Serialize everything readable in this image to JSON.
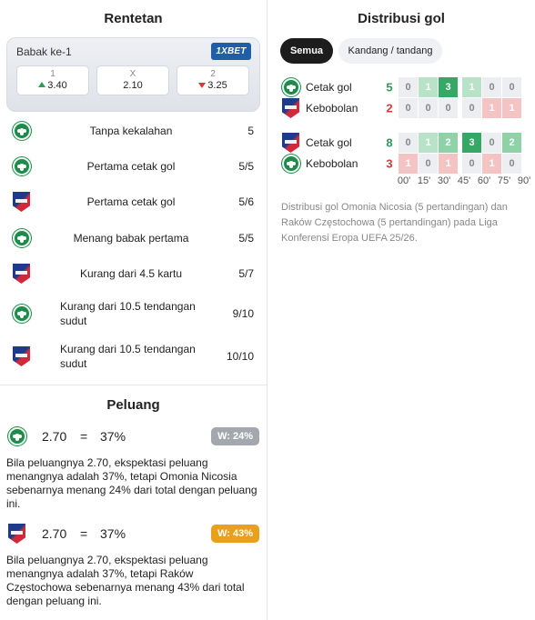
{
  "streak": {
    "title": "Rentetan",
    "odds": {
      "round": "Babak ke-1",
      "bookmaker": "1XBET",
      "items": [
        {
          "label": "1",
          "value": "3.40",
          "trend": "up"
        },
        {
          "label": "X",
          "value": "2.10",
          "trend": "none"
        },
        {
          "label": "2",
          "value": "3.25",
          "trend": "down"
        }
      ]
    },
    "rows": [
      {
        "team": "omonia",
        "text": "Tanpa kekalahan",
        "count": "5"
      },
      {
        "team": "omonia",
        "text": "Pertama cetak gol",
        "count": "5/5"
      },
      {
        "team": "rakow",
        "text": "Pertama cetak gol",
        "count": "5/6"
      },
      {
        "team": "omonia",
        "text": "Menang babak pertama",
        "count": "5/5"
      },
      {
        "team": "rakow",
        "text": "Kurang dari 4.5 kartu",
        "count": "5/7"
      },
      {
        "team": "omonia",
        "text": "Kurang dari 10.5 tendangan sudut",
        "count": "9/10"
      },
      {
        "team": "rakow",
        "text": "Kurang dari 10.5 tendangan sudut",
        "count": "10/10"
      }
    ]
  },
  "distribution": {
    "title": "Distribusi gol",
    "tabs": [
      "Semua",
      "Kandang / tandang"
    ],
    "groups": [
      {
        "rows": [
          {
            "team": "omonia",
            "label": "Cetak gol",
            "total": "5",
            "color": "green",
            "cells": [
              "0",
              "1",
              "3",
              "1",
              "0",
              "0"
            ]
          },
          {
            "team": "rakow",
            "label": "Kebobolan",
            "total": "2",
            "color": "red",
            "cells": [
              "0",
              "0",
              "0",
              "0",
              "1",
              "1"
            ]
          }
        ]
      },
      {
        "rows": [
          {
            "team": "rakow",
            "label": "Cetak gol",
            "total": "8",
            "color": "green",
            "cells": [
              "0",
              "1",
              "2",
              "3",
              "0",
              "2"
            ]
          },
          {
            "team": "omonia",
            "label": "Kebobolan",
            "total": "3",
            "color": "red",
            "cells": [
              "1",
              "0",
              "1",
              "0",
              "1",
              "0"
            ]
          }
        ]
      }
    ],
    "ticks": [
      "00'",
      "15'",
      "30'",
      "45'",
      "60'",
      "75'",
      "90'"
    ],
    "note": "Distribusi gol Omonia Nicosia (5 pertandingan) dan Raków Częstochowa (5 pertandingan) pada Liga Konferensi Eropa UEFA 25/26."
  },
  "chances": {
    "title": "Peluang",
    "items": [
      {
        "team": "omonia",
        "odd": "2.70",
        "eq": "=",
        "pct": "37%",
        "badge": "W: 24%",
        "badge_color": "#a4a8ae",
        "desc": "Bila peluangnya 2.70, ekspektasi peluang menangnya adalah 37%, tetapi Omonia Nicosia sebenarnya menang 24% dari total dengan peluang ini."
      },
      {
        "team": "rakow",
        "odd": "2.70",
        "eq": "=",
        "pct": "37%",
        "badge": "W: 43%",
        "badge_color": "#e9a11b",
        "desc": "Bila peluangnya 2.70, ekspektasi peluang menangnya adalah 37%, tetapi Raków Częstochowa sebenarnya menang 43% dari total dengan peluang ini."
      }
    ]
  },
  "colors": {
    "green": "#2e9a5b",
    "red": "#d83a3a",
    "bookmaker": "#1f5fa8"
  }
}
